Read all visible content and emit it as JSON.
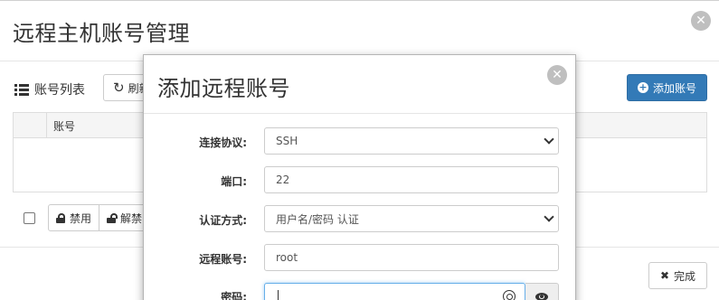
{
  "background": {
    "title": "远程主机账号管理",
    "list_title": "账号列表",
    "refresh_label": "刷新",
    "add_account_label": "添加账号",
    "table": {
      "columns": [
        "",
        "账号"
      ],
      "rows": []
    },
    "disable_label": "禁用",
    "unlock_label": "解禁",
    "finish_label": "完成"
  },
  "dialog": {
    "title": "添加远程账号",
    "fields": {
      "protocol": {
        "label": "连接协议:",
        "value": "SSH"
      },
      "port": {
        "label": "端口:",
        "value": "22"
      },
      "auth_method": {
        "label": "认证方式:",
        "value": "用户名/密码 认证"
      },
      "remote_account": {
        "label": "远程账号:",
        "value": "root"
      },
      "password": {
        "label": "密码:",
        "value": ""
      }
    }
  },
  "icons": {
    "close": "close-icon",
    "list": "list-icon",
    "refresh": "refresh-icon",
    "add": "plus-circle-icon",
    "lock": "lock-icon",
    "unlock": "unlock-icon",
    "finish": "x-icon",
    "chevron": "chevron-down-icon",
    "key": "key-icon",
    "eye": "eye-icon"
  },
  "colors": {
    "primary": "#337ab7",
    "close_circle": "#bfbfbf",
    "table_header": "#f5f5f5",
    "focus_border": "#66afe9"
  }
}
